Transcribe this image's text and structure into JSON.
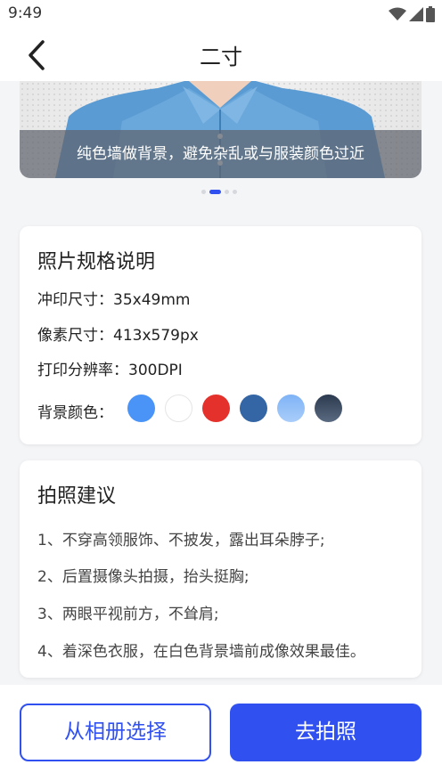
{
  "status_bar": {
    "time": "9:49"
  },
  "nav": {
    "title": "二寸"
  },
  "banner": {
    "caption": "纯色墙做背景，避免杂乱或与服装颜色过近",
    "page_count": 4,
    "active_page": 2
  },
  "spec_card": {
    "title": "照片规格说明",
    "print_size": "冲印尺寸：35x49mm",
    "pixel_size": "像素尺寸：413x579px",
    "resolution": "打印分辨率：300DPI",
    "bg_label": "背景颜色：",
    "bg_colors": [
      "#4a94f8",
      "#ffffff",
      "#e5312c",
      "#3465a4",
      "#a9cdfa",
      "#3e4f66"
    ]
  },
  "tips_card": {
    "title": "拍照建议",
    "tips": [
      "1、不穿高领服饰、不披发，露出耳朵脖子;",
      "2、后置摄像头拍摄，抬头挺胸;",
      "3、两眼平视前方，不耸肩;",
      "4、着深色衣服，在白色背景墙前成像效果最佳。"
    ]
  },
  "actions": {
    "album_label": "从相册选择",
    "shoot_label": "去拍照"
  }
}
